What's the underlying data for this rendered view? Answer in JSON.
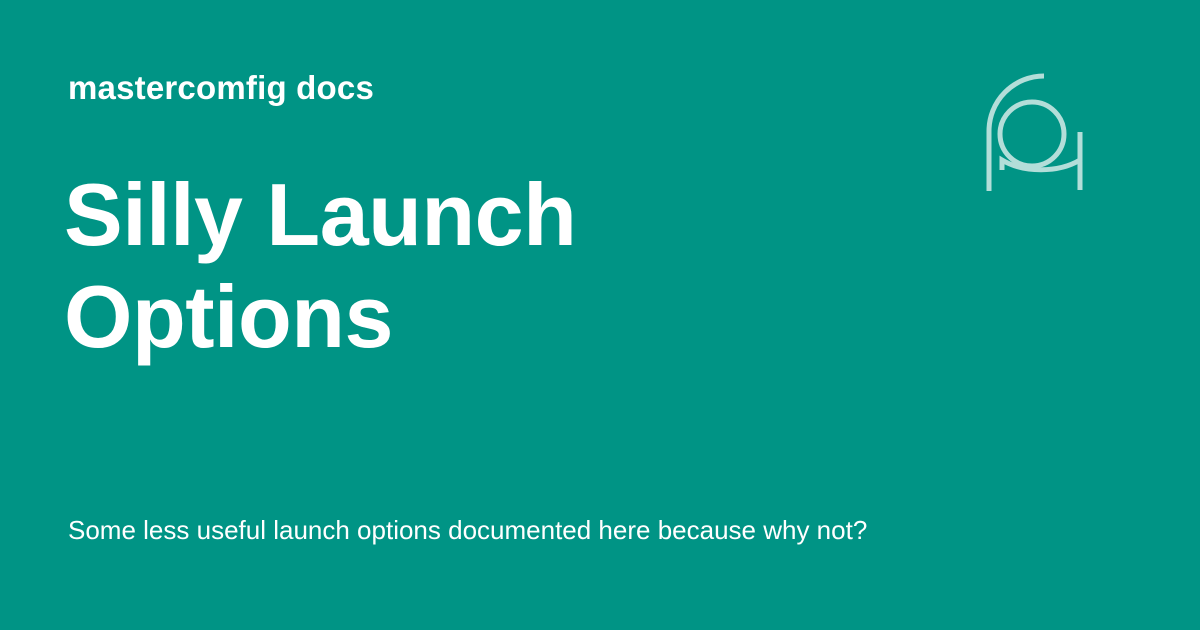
{
  "card": {
    "site_name": "mastercomfig docs",
    "title": "Silly Launch Options",
    "description": "Some less useful launch options documented here because why not?",
    "logo_icon": "mastercomfig-logo-icon",
    "colors": {
      "background": "#009485",
      "text": "#ffffff",
      "logo_stroke": "#b3ded9"
    }
  }
}
